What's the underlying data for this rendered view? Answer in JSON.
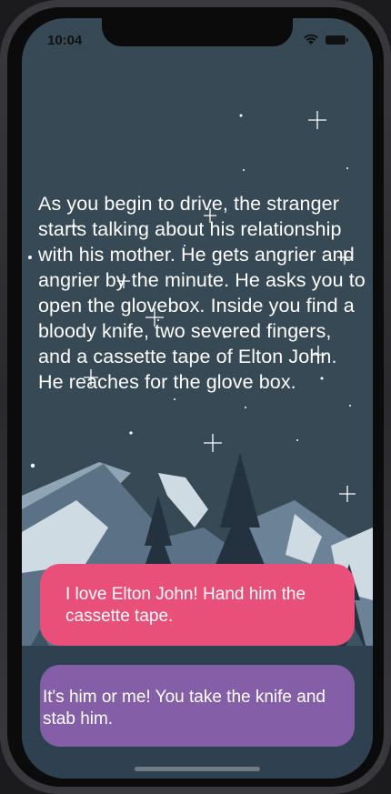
{
  "status_bar": {
    "time": "10:04"
  },
  "story": {
    "text": "As you begin to drive, the stranger starts talking about his relationship with his mother. He gets angrier and angrier by the minute. He asks you to open the glovebox. Inside you find a bloody knife, two severed fingers, and a cassette tape of Elton John. He reaches for the glove box."
  },
  "choices": [
    {
      "label": "I love Elton John! Hand him the cassette tape.",
      "color": "#e8507a"
    },
    {
      "label": "It's him or me! You take the knife and stab him.",
      "color": "#855ea8"
    }
  ],
  "colors": {
    "sky": "#374955",
    "mountain_light": "#cfdbe3",
    "mountain_mid": "#5a7186",
    "tree_dark": "#243240"
  }
}
